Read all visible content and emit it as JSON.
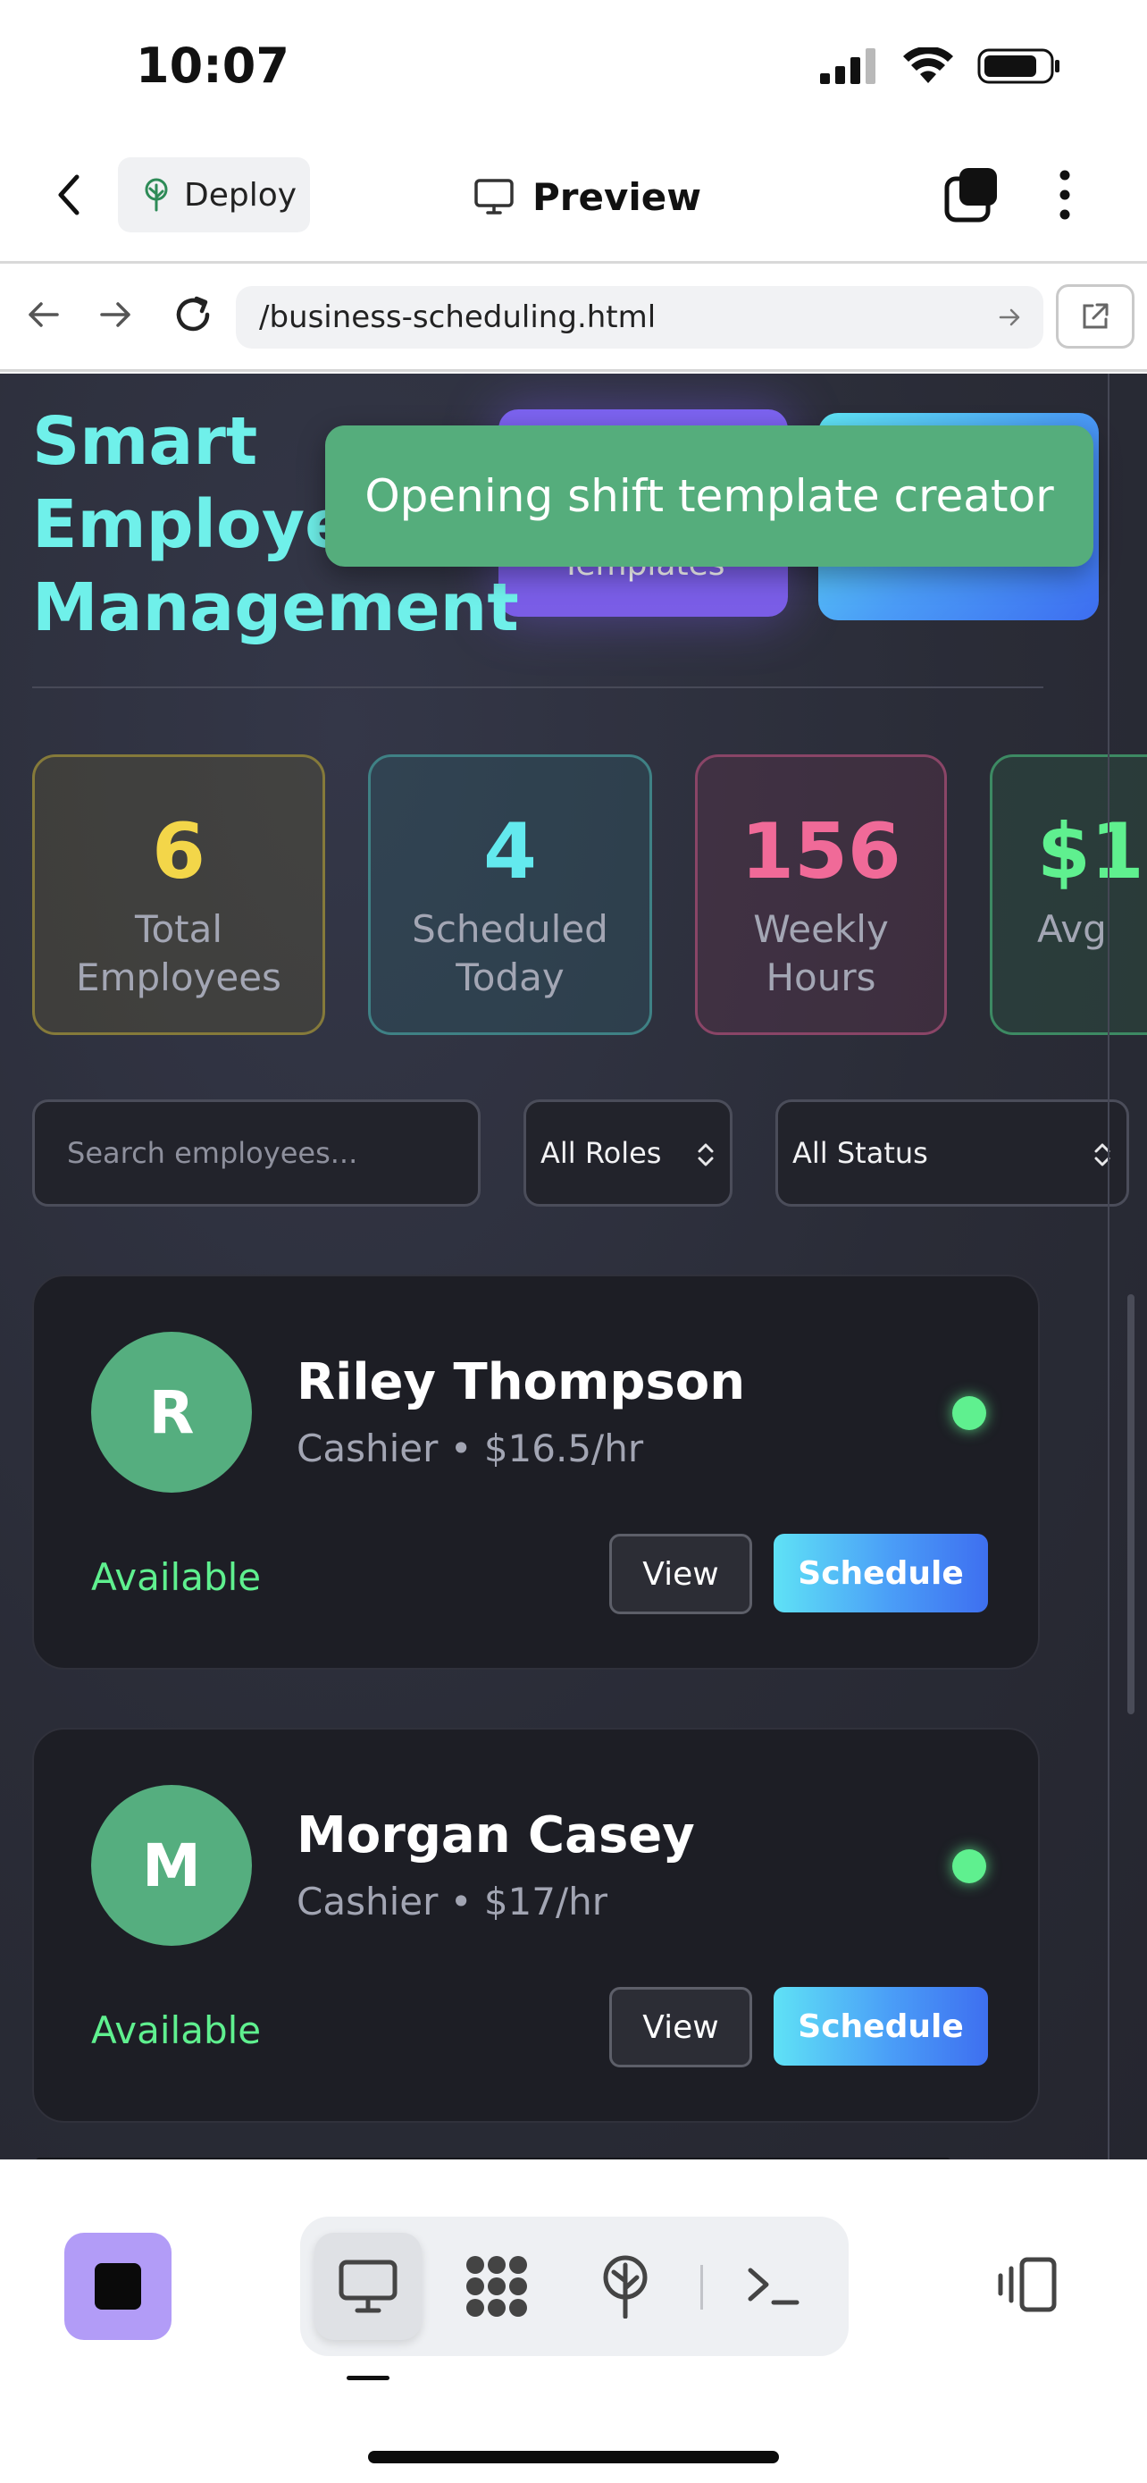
{
  "status_bar": {
    "time": "10:07"
  },
  "app_bar": {
    "deploy_label": "Deploy",
    "preview_label": "Preview"
  },
  "browser": {
    "url": "/business-scheduling.html"
  },
  "page": {
    "hero_title_lines": [
      "Smart",
      "Employee",
      "Management"
    ],
    "hero_button_purple_label": "Templates",
    "toast": "Opening shift template creator",
    "stats": [
      {
        "value": "6",
        "label_lines": [
          "Total",
          "Employees"
        ]
      },
      {
        "value": "4",
        "label_lines": [
          "Scheduled",
          "Today"
        ]
      },
      {
        "value": "156",
        "label_lines": [
          "Weekly",
          "Hours"
        ]
      },
      {
        "value": "$1",
        "label_lines": [
          "Avg"
        ]
      }
    ],
    "search_placeholder": "Search employees...",
    "roles_filter": "All Roles",
    "status_filter": "All Status",
    "employees": [
      {
        "initial": "R",
        "name": "Riley Thompson",
        "role_rate": "Cashier • $16.5/hr",
        "status": "Available",
        "view_label": "View",
        "schedule_label": "Schedule"
      },
      {
        "initial": "M",
        "name": "Morgan Casey",
        "role_rate": "Cashier • $17/hr",
        "status": "Available",
        "view_label": "View",
        "schedule_label": "Schedule"
      }
    ]
  },
  "colors": {
    "accent_cyan": "#6ff0ea",
    "toast_green": "#55ad7c",
    "status_green": "#5ff08f",
    "purple": "#7c63f0",
    "stop_button": "#b29cf7"
  },
  "icons": {
    "status": [
      "signal-icon",
      "wifi-icon",
      "battery-icon"
    ],
    "app_bar": [
      "back-icon",
      "deploy-tree-icon",
      "monitor-icon",
      "tabs-icon",
      "more-vertical-icon"
    ],
    "browser": [
      "nav-back-icon",
      "nav-forward-icon",
      "reload-icon",
      "go-arrow-icon",
      "external-link-icon"
    ],
    "dock": [
      "stop-icon",
      "monitor-icon",
      "grid-icon",
      "deploy-tree-icon",
      "terminal-icon",
      "panel-icon"
    ]
  }
}
